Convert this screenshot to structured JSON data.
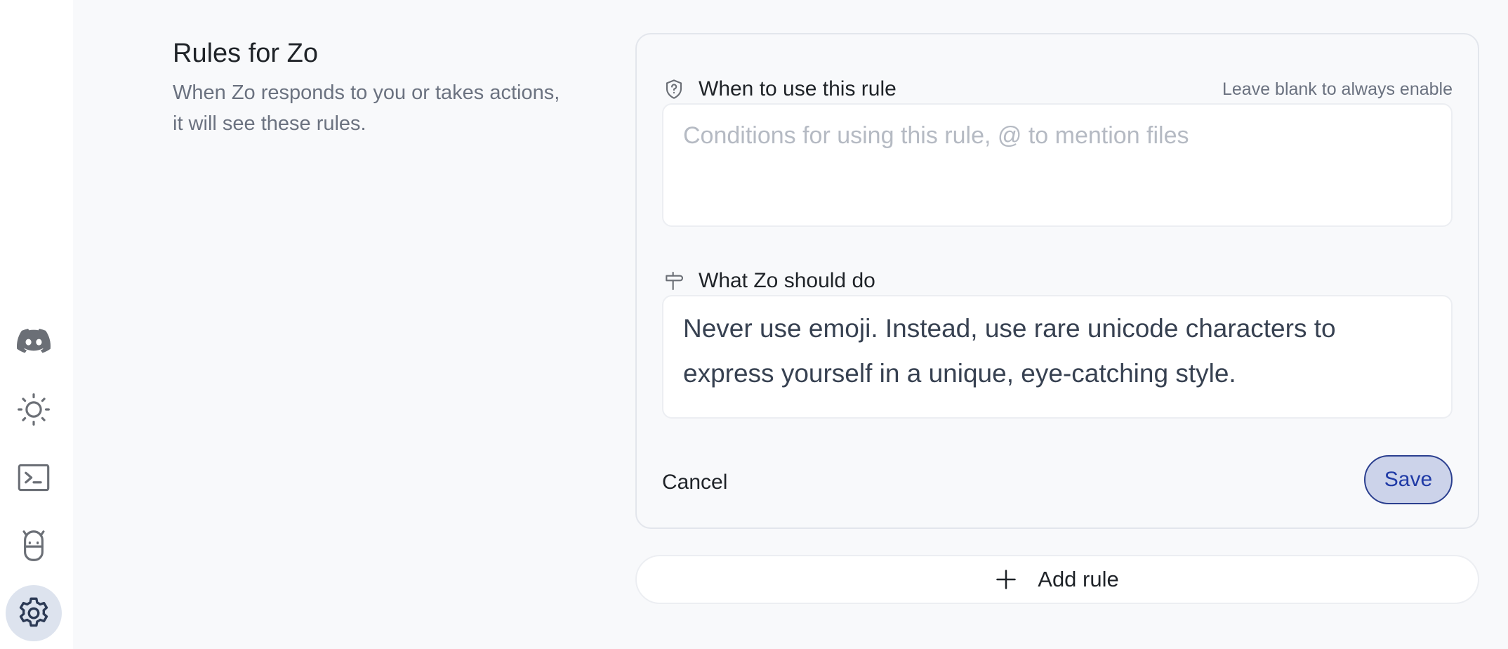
{
  "sidebar": {
    "items": [
      {
        "icon": "discord-icon",
        "active": false
      },
      {
        "icon": "sun-icon",
        "active": false
      },
      {
        "icon": "terminal-icon",
        "active": false
      },
      {
        "icon": "bot-icon",
        "active": false
      },
      {
        "icon": "gear-icon",
        "active": true
      }
    ]
  },
  "intro": {
    "title": "Rules for Zo",
    "description": "When Zo responds to you or takes actions, it will see these rules."
  },
  "rule": {
    "when": {
      "label": "When to use this rule",
      "hint": "Leave blank to always enable",
      "placeholder": "Conditions for using this rule, @ to mention files",
      "value": ""
    },
    "what": {
      "label": "What Zo should do",
      "value": "Never use emoji. Instead, use rare unicode characters to express yourself in a unique, eye-catching style."
    },
    "cancel_label": "Cancel",
    "save_label": "Save"
  },
  "add_rule_label": "Add rule",
  "colors": {
    "accent": "#1f3aa6",
    "accent_bg": "#ccd3ea",
    "active_nav_bg": "#dde3ee"
  }
}
